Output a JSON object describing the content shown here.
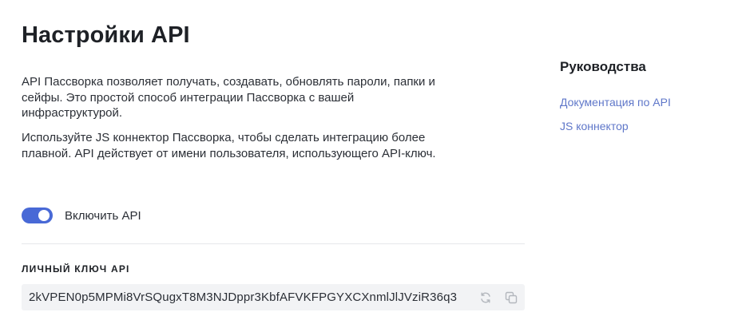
{
  "page": {
    "title": "Настройки API",
    "description_1": "API Пассворка позволяет получать, создавать, обновлять пароли, папки и сейфы. Это простой способ интеграции Пассворка с вашей инфраструктурой.",
    "description_2": "Используйте JS коннектор Пассворка, чтобы сделать интеграцию более плавной. API действует от имени пользователя, использующего API-ключ."
  },
  "api_toggle": {
    "label": "Включить API",
    "enabled": true
  },
  "api_key": {
    "heading": "ЛИЧНЫЙ КЛЮЧ API",
    "value": "2kVPEN0p5MPMi8VrSQugxT8M3NJDppr3KbfAFVKFPGYXCXnmlJlJVziR36q3",
    "regenerate_icon": "refresh-icon",
    "copy_icon": "copy-icon"
  },
  "guides": {
    "title": "Руководства",
    "links": [
      {
        "label": "Документация по API"
      },
      {
        "label": "JS коннектор"
      }
    ]
  },
  "colors": {
    "accent": "#4869d6",
    "link": "#5f77c9",
    "key_background": "#f2f3f5",
    "divider": "#e6e8eb"
  }
}
